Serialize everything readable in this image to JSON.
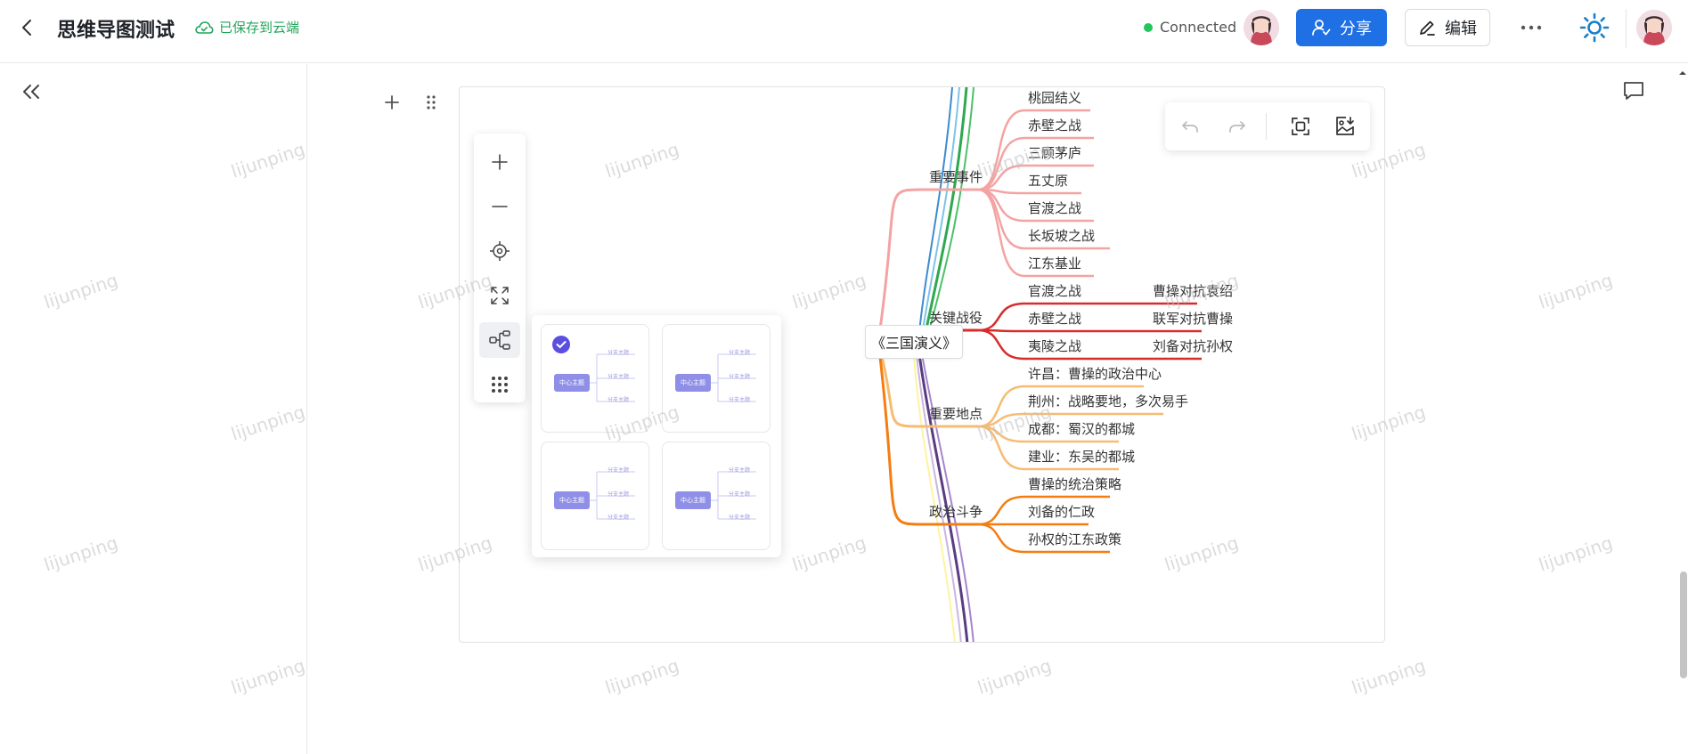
{
  "header": {
    "title": "思维导图测试",
    "save_status": "已保存到云端",
    "connection_status": "Connected",
    "share_label": "分享",
    "edit_label": "编辑"
  },
  "watermark": "lijunping",
  "mindmap": {
    "root": "《三国演义》",
    "branches": [
      {
        "label": "重要事件",
        "color": "#f4a3a3",
        "children": [
          "桃园结义",
          "赤壁之战",
          "三顾茅庐",
          "五丈原",
          "官渡之战",
          "长坂坡之战",
          "江东基业"
        ]
      },
      {
        "label": "关键战役",
        "color": "#d92b2b",
        "children": [
          {
            "label": "官渡之战",
            "detail": "曹操对抗袁绍"
          },
          {
            "label": "赤壁之战",
            "detail": "联军对抗曹操"
          },
          {
            "label": "夷陵之战",
            "detail": "刘备对抗孙权"
          }
        ]
      },
      {
        "label": "重要地点",
        "color": "#f6bc73",
        "children": [
          "许昌：曹操的政治中心",
          "荆州：战略要地，多次易手",
          "成都：蜀汉的都城",
          "建业：东吴的都城"
        ]
      },
      {
        "label": "政治斗争",
        "color": "#f47d12",
        "children": [
          "曹操的统治策略",
          "刘备的仁政",
          "孙权的江东政策"
        ]
      }
    ]
  },
  "layout_options": {
    "center_label": "中心主题",
    "branch_label": "分支主题",
    "selected_index": 0
  },
  "colors": {
    "accent": "#1f6fe5",
    "connected": "#22c55e",
    "saved": "#22a559",
    "layout_selected": "#5b4fe0"
  }
}
